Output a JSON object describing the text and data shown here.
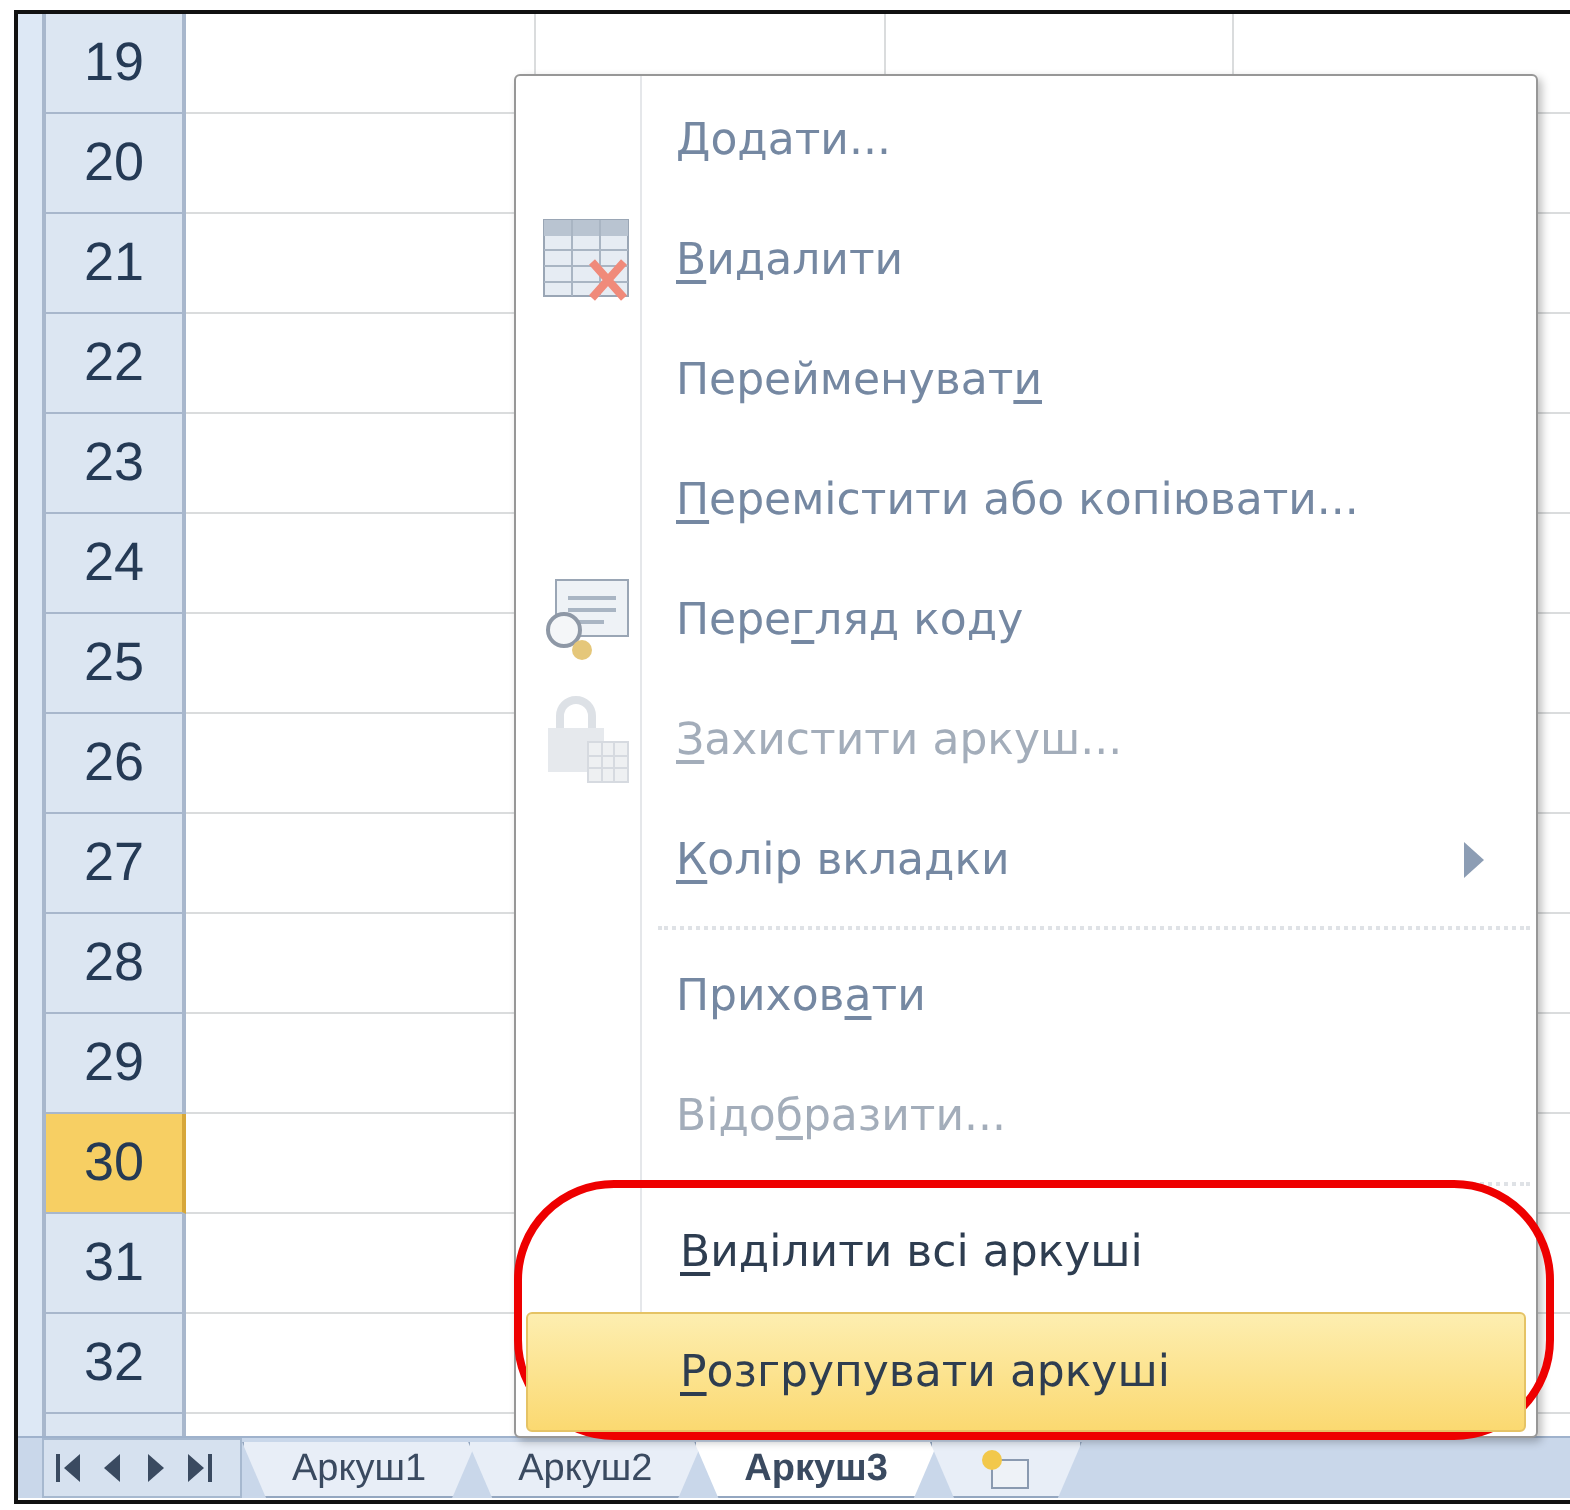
{
  "sheet": {
    "row_headers": [
      {
        "label": "19",
        "selected": false
      },
      {
        "label": "20",
        "selected": false
      },
      {
        "label": "21",
        "selected": false
      },
      {
        "label": "22",
        "selected": false
      },
      {
        "label": "23",
        "selected": false
      },
      {
        "label": "24",
        "selected": false
      },
      {
        "label": "25",
        "selected": false
      },
      {
        "label": "26",
        "selected": false
      },
      {
        "label": "27",
        "selected": false
      },
      {
        "label": "28",
        "selected": false
      },
      {
        "label": "29",
        "selected": false
      },
      {
        "label": "30",
        "selected": true
      },
      {
        "label": "31",
        "selected": false
      },
      {
        "label": "32",
        "selected": false
      }
    ]
  },
  "context_menu": {
    "items": [
      {
        "kind": "item",
        "key": "Д",
        "suffix": "одати...",
        "disabled": false,
        "circled": false,
        "highlighted": false
      },
      {
        "kind": "item",
        "key": "В",
        "suffix": "идалити",
        "disabled": false,
        "circled": false,
        "highlighted": false
      },
      {
        "kind": "item",
        "prefix": "Перейменуват",
        "key": "и",
        "disabled": false,
        "circled": false,
        "highlighted": false
      },
      {
        "kind": "item",
        "key": "П",
        "suffix": "еремістити або копіювати...",
        "disabled": false,
        "circled": false,
        "highlighted": false
      },
      {
        "kind": "item",
        "prefix": "Пере",
        "key": "г",
        "suffix": "ляд коду",
        "disabled": false,
        "circled": false,
        "highlighted": false
      },
      {
        "kind": "item",
        "key": "З",
        "suffix": "ахистити аркуш...",
        "disabled": true,
        "circled": false,
        "highlighted": false
      },
      {
        "kind": "item",
        "key": "К",
        "suffix": "олір вкладки",
        "disabled": false,
        "circled": false,
        "highlighted": false,
        "has_submenu": true
      },
      {
        "kind": "separator"
      },
      {
        "kind": "item",
        "prefix": "Прихов",
        "key": "а",
        "suffix": "ти",
        "disabled": false,
        "circled": false,
        "highlighted": false
      },
      {
        "kind": "item",
        "prefix": "Відо",
        "key": "б",
        "suffix": "разити...",
        "disabled": true,
        "circled": false,
        "highlighted": false
      },
      {
        "kind": "separator"
      },
      {
        "kind": "item",
        "key": "В",
        "suffix": "иділити всі аркуші",
        "disabled": false,
        "circled": true,
        "highlighted": false
      },
      {
        "kind": "item",
        "key": "Р",
        "suffix": "озгрупувати аркуші",
        "disabled": false,
        "circled": true,
        "highlighted": true
      }
    ]
  },
  "sheet_tabs": [
    {
      "label": "Аркуш1",
      "selected": false
    },
    {
      "label": "Аркуш2",
      "selected": false
    },
    {
      "label": "Аркуш3",
      "selected": true
    }
  ]
}
